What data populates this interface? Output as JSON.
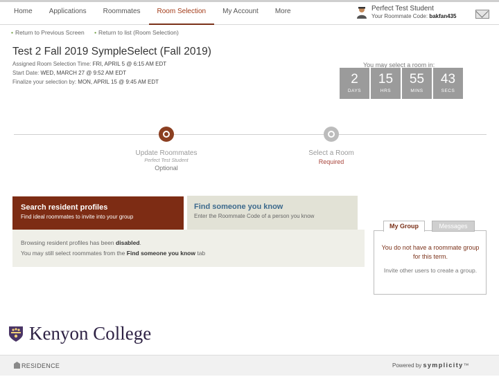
{
  "nav": {
    "items": [
      {
        "label": "Home"
      },
      {
        "label": "Applications"
      },
      {
        "label": "Roommates"
      },
      {
        "label": "Room Selection"
      },
      {
        "label": "My Account"
      },
      {
        "label": "More"
      }
    ],
    "active_index": 3
  },
  "user": {
    "name": "Perfect Test Student",
    "code_label": "Your Roommate Code:",
    "code": "bakfan435"
  },
  "breadcrumbs": [
    {
      "label": "Return to Previous Screen"
    },
    {
      "label": "Return to list (Room Selection)"
    }
  ],
  "page": {
    "title": "Test 2 Fall 2019 SympleSelect (Fall 2019)",
    "assigned_label": "Assigned Room Selection Time:",
    "assigned_value": "FRI, APRIL 5 @ 6:15 AM EDT",
    "start_label": "Start Date:",
    "start_value": "WED, MARCH 27 @ 9:52 AM EDT",
    "finalize_label": "Finalize your selection by:",
    "finalize_value": "MON, APRIL 15 @ 9:45 AM EDT"
  },
  "countdown": {
    "label": "You may select a room in:",
    "units": [
      {
        "value": "2",
        "unit": "DAYS"
      },
      {
        "value": "15",
        "unit": "HRS"
      },
      {
        "value": "55",
        "unit": "MINS"
      },
      {
        "value": "43",
        "unit": "SECS"
      }
    ]
  },
  "steps": [
    {
      "title": "Update Roommates",
      "sub": "Perfect Test Student",
      "note": "Optional"
    },
    {
      "title": "Select a Room",
      "note": "Required"
    }
  ],
  "tabs": {
    "search": {
      "title": "Search resident profiles",
      "sub": "Find ideal roommates to invite into your group"
    },
    "find": {
      "title": "Find someone you know",
      "sub": "Enter the Roommate Code of a person you know"
    }
  },
  "panel": {
    "line1_pre": "Browsing resident profiles has been",
    "line1_bold": "disabled",
    "line1_post": ".",
    "line2_pre": "You may still select roommates from the",
    "line2_bold": "Find someone you know",
    "line2_post": "tab"
  },
  "group": {
    "tab_mygroup": "My Group",
    "tab_messages": "Messages",
    "line1": "You do not have a roommate group for this term.",
    "line2": "Invite other users to create a group."
  },
  "brand": {
    "college": "Kenyon College",
    "residence": "RESIDENCE",
    "powered_by": "Powered by",
    "symplicity": "symplicity"
  },
  "colors": {
    "accent": "#7d2c14",
    "link_blue": "#3d6a8d",
    "required_red": "#a8443b",
    "countdown_gray": "#9b9b9b",
    "college_purple": "#2e2244"
  }
}
